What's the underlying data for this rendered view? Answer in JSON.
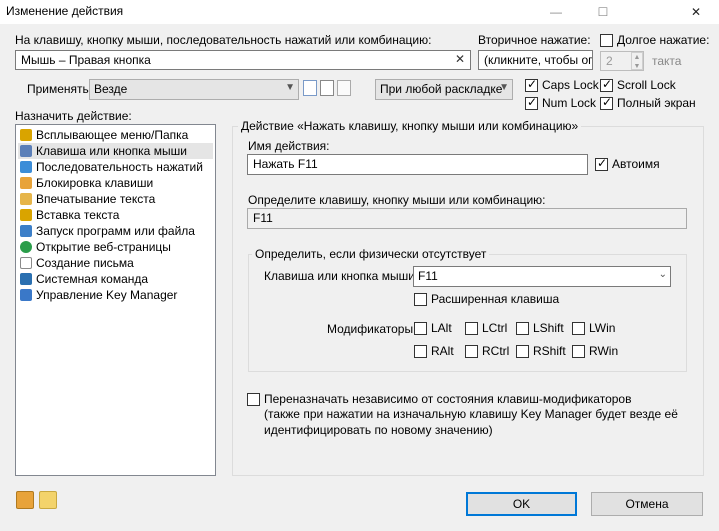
{
  "window": {
    "title": "Изменение действия",
    "controls": [
      "—",
      "☐",
      "✕"
    ]
  },
  "key_field": {
    "label": "На клавишу, кнопку мыши, последовательность нажатий или комбинацию:",
    "value": "Мышь – Правая кнопка",
    "clear_glyph": "✕"
  },
  "secondary": {
    "label": "Вторичное нажатие:",
    "value": "(кликните, чтобы опр"
  },
  "long_press": {
    "label": "Долгое нажатие:",
    "checked": false,
    "value": "2",
    "unit": "такта"
  },
  "apply": {
    "label": "Применять",
    "value": "Везде",
    "layout_value": "При любой раскладке"
  },
  "locks": [
    {
      "label": "Caps Lock",
      "checked": true
    },
    {
      "label": "Scroll Lock",
      "checked": true
    },
    {
      "label": "Num Lock",
      "checked": true
    },
    {
      "label": "Полный экран",
      "checked": true
    }
  ],
  "assign": {
    "label": "Назначить действие:",
    "items": [
      {
        "label": "Всплывающее меню/Папка",
        "icon": "menu-folder-icon",
        "color": "#d9a400"
      },
      {
        "label": "Клавиша или кнопка мыши",
        "icon": "mouse-icon",
        "color": "#5b7fb8",
        "selected": true
      },
      {
        "label": "Последовательность нажатий",
        "icon": "sequence-icon",
        "color": "#3c8dd8"
      },
      {
        "label": "Блокировка клавиши",
        "icon": "lock-key-icon",
        "color": "#e8a33a"
      },
      {
        "label": "Впечатывание текста",
        "icon": "type-text-icon",
        "color": "#e6b54a"
      },
      {
        "label": "Вставка текста",
        "icon": "paste-text-icon",
        "color": "#d9a400"
      },
      {
        "label": "Запуск программ или файла",
        "icon": "run-program-icon",
        "color": "#3c7fc8"
      },
      {
        "label": "Открытие веб-страницы",
        "icon": "web-page-icon",
        "color": "#2a9d4a"
      },
      {
        "label": "Создание письма",
        "icon": "mail-icon",
        "color": "#8a8a8a"
      },
      {
        "label": "Системная команда",
        "icon": "system-command-icon",
        "color": "#2a6fb0"
      },
      {
        "label": "Управление Key Manager",
        "icon": "key-manager-icon",
        "color": "#3a78c8"
      }
    ]
  },
  "action_group": {
    "title": "Действие «Нажать клавишу, кнопку мыши или комбинацию»",
    "name_label": "Имя действия:",
    "name_value": "Нажать F11",
    "auto_name_label": "Автоимя",
    "auto_name_checked": true,
    "define_label": "Определите клавишу, кнопку мыши или комбинацию:",
    "define_value": "F11"
  },
  "physical_group": {
    "title": "Определить, если физически отсутствует",
    "key_label": "Клавиша или кнопка мыши",
    "key_value": "F11",
    "extended_label": "Расширенная клавиша",
    "modifiers_label": "Модификаторы",
    "modifiers": [
      [
        "LAlt",
        "LCtrl",
        "LShift",
        "LWin"
      ],
      [
        "RAlt",
        "RCtrl",
        "RShift",
        "RWin"
      ]
    ]
  },
  "remap": {
    "line1": "Переназначать независимо от состояния клавиш-модификаторов",
    "line2": "(также при нажатии на изначальную клавишу Key Manager будет везде её",
    "line3": "идентифицировать по новому значению)"
  },
  "buttons": {
    "ok": "OK",
    "cancel": "Отмена"
  }
}
